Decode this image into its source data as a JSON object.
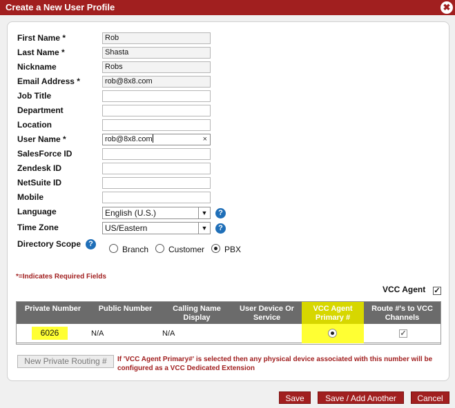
{
  "dialog": {
    "title": "Create a New User Profile",
    "close_symbol": "✖"
  },
  "form": {
    "fields": [
      {
        "label": "First Name *",
        "value": "Rob"
      },
      {
        "label": "Last Name *",
        "value": "Shasta"
      },
      {
        "label": "Nickname",
        "value": "Robs"
      },
      {
        "label": "Email Address *",
        "value": "rob@8x8.com"
      },
      {
        "label": "Job Title",
        "value": ""
      },
      {
        "label": "Department",
        "value": ""
      },
      {
        "label": "Location",
        "value": ""
      },
      {
        "label": "User Name *",
        "value": "rob@8x8.com"
      },
      {
        "label": "SalesForce ID",
        "value": ""
      },
      {
        "label": "Zendesk ID",
        "value": ""
      },
      {
        "label": "NetSuite ID",
        "value": ""
      },
      {
        "label": "Mobile",
        "value": ""
      }
    ],
    "clear_symbol": "×",
    "language": {
      "label": "Language",
      "value": "English (U.S.)"
    },
    "timezone": {
      "label": "Time Zone",
      "value": "US/Eastern"
    },
    "directory_scope": {
      "label": "Directory Scope",
      "options": [
        "Branch",
        "Customer",
        "PBX"
      ],
      "selected": "PBX"
    },
    "help_symbol": "?",
    "dropdown_arrow": "▼"
  },
  "required_note": "*=Indicates Required Fields",
  "vcc_agent": {
    "label": "VCC Agent",
    "checked": true,
    "check_symbol": "✓"
  },
  "table": {
    "headers": [
      "Private Number",
      "Public Number",
      "Calling Name Display",
      "User Device Or Service",
      "VCC Agent Primary #",
      "Route #'s to VCC Channels"
    ],
    "rows": [
      {
        "private_number": "6026",
        "public_number": "N/A",
        "calling_name": "N/A",
        "device": "",
        "vcc_primary": true,
        "route_to_vcc": true
      }
    ]
  },
  "new_routing_button": "New Private Routing #",
  "warning": "If 'VCC Agent Primary#' is selected then any physical device associated with this number will be configured as a VCC Dedicated Extension",
  "buttons": {
    "save": "Save",
    "save_add": "Save / Add Another",
    "cancel": "Cancel"
  },
  "colors": {
    "brand": "#a11f1f",
    "highlight": "#ffff33",
    "help": "#1f6fb8"
  }
}
